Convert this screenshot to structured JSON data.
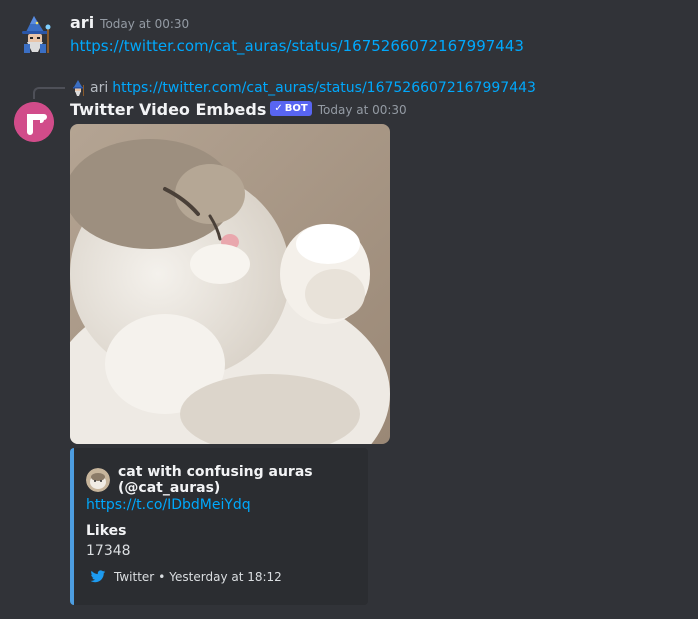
{
  "messages": [
    {
      "author": "ari",
      "timestamp": "Today at 00:30",
      "link": "https://twitter.com/cat_auras/status/1675266072167997443",
      "avatar_icon": "wizard-avatar"
    },
    {
      "reply": {
        "author": "ari",
        "link": "https://twitter.com/cat_auras/status/1675266072167997443"
      },
      "author": "Twitter Video Embeds",
      "badge": "BOT",
      "badge_check": "✓",
      "timestamp": "Today at 00:30",
      "avatar_icon": "bot-avatar",
      "media": {
        "description_icon": "cat-photo"
      },
      "embed": {
        "author": "cat with confusing auras (@cat_auras)",
        "description_link": "https://t.co/IDbdMeiYdq",
        "field_name": "Likes",
        "field_value": "17348",
        "footer_source": "Twitter",
        "footer_separator": "•",
        "footer_time": "Yesterday at 18:12",
        "accent_color": "#4d9de0"
      }
    }
  ],
  "colors": {
    "background": "#313338",
    "link": "#00a8fc",
    "bot_badge": "#5865f2",
    "embed_bg": "#2b2d31",
    "muted": "#949ba4"
  }
}
